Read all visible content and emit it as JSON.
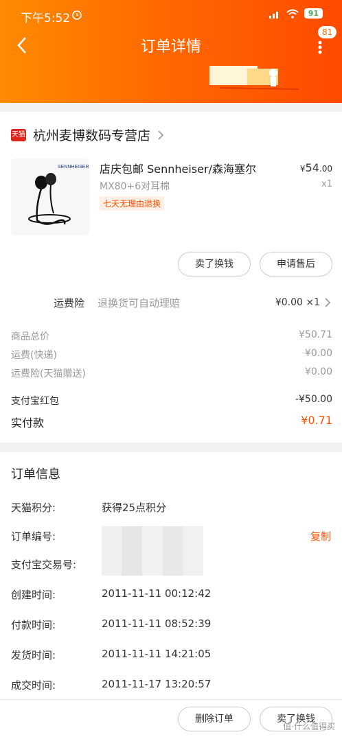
{
  "status_bar": {
    "time": "下午5:52",
    "battery": "91"
  },
  "header": {
    "title": "订单详情",
    "badge": "81"
  },
  "shop": {
    "logo_text": "天猫",
    "name": "杭州麦博数码专营店"
  },
  "product": {
    "title": "店庆包邮 Sennheiser/森海塞尔",
    "spec": "MX80+6对耳棉",
    "tag": "七天无理由退换",
    "price_currency": "¥",
    "price_int": "54",
    "price_dec": ".00",
    "qty": "x1",
    "brand_text": "SENNHEISER"
  },
  "actions": {
    "sell": "卖了换钱",
    "after_sale": "申请售后"
  },
  "insurance": {
    "label": "运费险",
    "desc": "退换货可自动理赔",
    "price": "¥0.00 ×1"
  },
  "summary": [
    {
      "label": "商品总价",
      "value": "¥50.71"
    },
    {
      "label": "运费(快递)",
      "value": "¥0.00"
    },
    {
      "label": "运费险(天猫赠送)",
      "value": "¥0.00"
    },
    {
      "label": "支付宝红包",
      "value": "-¥50.00"
    },
    {
      "label": "实付款",
      "value": "¥0.71"
    }
  ],
  "order_info": {
    "title": "订单信息",
    "rows": [
      {
        "label": "天猫积分:",
        "value": "获得25点积分"
      },
      {
        "label": "订单编号:",
        "value": ""
      },
      {
        "label": "支付宝交易号:",
        "value": ""
      },
      {
        "label": "创建时间:",
        "value": "2011-11-11 00:12:42"
      },
      {
        "label": "付款时间:",
        "value": "2011-11-11 08:52:39"
      },
      {
        "label": "发货时间:",
        "value": "2011-11-11 14:21:05"
      },
      {
        "label": "成交时间:",
        "value": "2011-11-17 13:20:57"
      }
    ],
    "copy": "复制"
  },
  "bottom": {
    "delete": "删除订单",
    "sell": "卖了换钱"
  },
  "watermark": "值·什么值得买",
  "colors": {
    "accent": "#ff5000",
    "header_start": "#ff8a00",
    "header_end": "#ff4a00"
  }
}
